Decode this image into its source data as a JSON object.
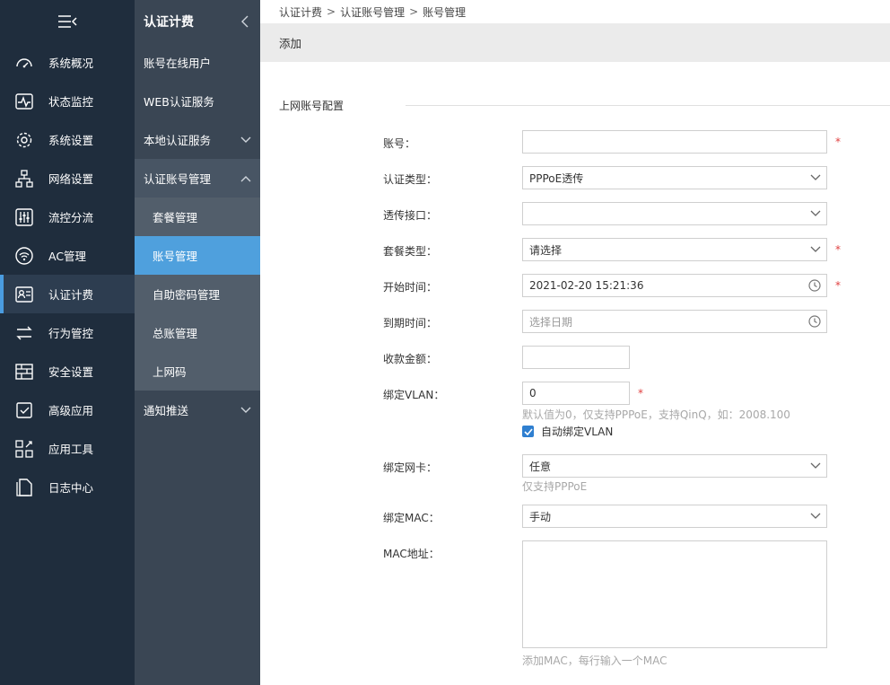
{
  "nav": {
    "items": [
      {
        "label": "系统概况",
        "icon": "dashboard-icon"
      },
      {
        "label": "状态监控",
        "icon": "monitor-icon"
      },
      {
        "label": "系统设置",
        "icon": "gear-icon"
      },
      {
        "label": "网络设置",
        "icon": "network-icon"
      },
      {
        "label": "流控分流",
        "icon": "sliders-icon"
      },
      {
        "label": "AC管理",
        "icon": "wifi-icon"
      },
      {
        "label": "认证计费",
        "icon": "id-card-icon"
      },
      {
        "label": "行为管控",
        "icon": "arrows-icon"
      },
      {
        "label": "安全设置",
        "icon": "firewall-icon"
      },
      {
        "label": "高级应用",
        "icon": "check-doc-icon"
      },
      {
        "label": "应用工具",
        "icon": "tools-icon"
      },
      {
        "label": "日志中心",
        "icon": "log-icon"
      }
    ],
    "active": "认证计费"
  },
  "subnav": {
    "title": "认证计费",
    "items": [
      {
        "label": "账号在线用户"
      },
      {
        "label": "WEB认证服务"
      },
      {
        "label": "本地认证服务"
      },
      {
        "label": "认证账号管理"
      },
      {
        "label": "通知推送"
      }
    ],
    "sub_items": [
      {
        "label": "套餐管理"
      },
      {
        "label": "账号管理"
      },
      {
        "label": "自助密码管理"
      },
      {
        "label": "总账管理"
      },
      {
        "label": "上网码"
      }
    ],
    "active": "账号管理"
  },
  "breadcrumb": [
    "认证计费",
    "认证账号管理",
    "账号管理"
  ],
  "breadcrumb_sep": ">",
  "page_title": "添加",
  "section_title": "上网账号配置",
  "form": {
    "account": {
      "label": "账号：",
      "value": ""
    },
    "auth_type": {
      "label": "认证类型：",
      "value": "PPPoE透传"
    },
    "pass_interface": {
      "label": "透传接口：",
      "value": ""
    },
    "package_type": {
      "label": "套餐类型：",
      "value": "请选择"
    },
    "start_time": {
      "label": "开始时间：",
      "value": "2021-02-20 15:21:36"
    },
    "end_time": {
      "label": "到期时间：",
      "placeholder": "选择日期"
    },
    "amount": {
      "label": "收款金额：",
      "value": ""
    },
    "vlan": {
      "label": "绑定VLAN：",
      "value": "0",
      "hint": "默认值为0，仅支持PPPoE，支持QinQ，如：2008.100",
      "auto_label": "自动绑定VLAN",
      "auto_checked": true
    },
    "nic": {
      "label": "绑定网卡：",
      "value": "任意",
      "hint": "仅支持PPPoE"
    },
    "mac_bind": {
      "label": "绑定MAC：",
      "value": "手动"
    },
    "mac_address": {
      "label": "MAC地址：",
      "value": "",
      "hint": "添加MAC，每行输入一个MAC"
    }
  },
  "required_mark": "*",
  "colors": {
    "nav_bg": "#1f2d3d",
    "subnav_bg": "#3a4654",
    "accent": "#4fa0dd",
    "required": "#e04040"
  }
}
